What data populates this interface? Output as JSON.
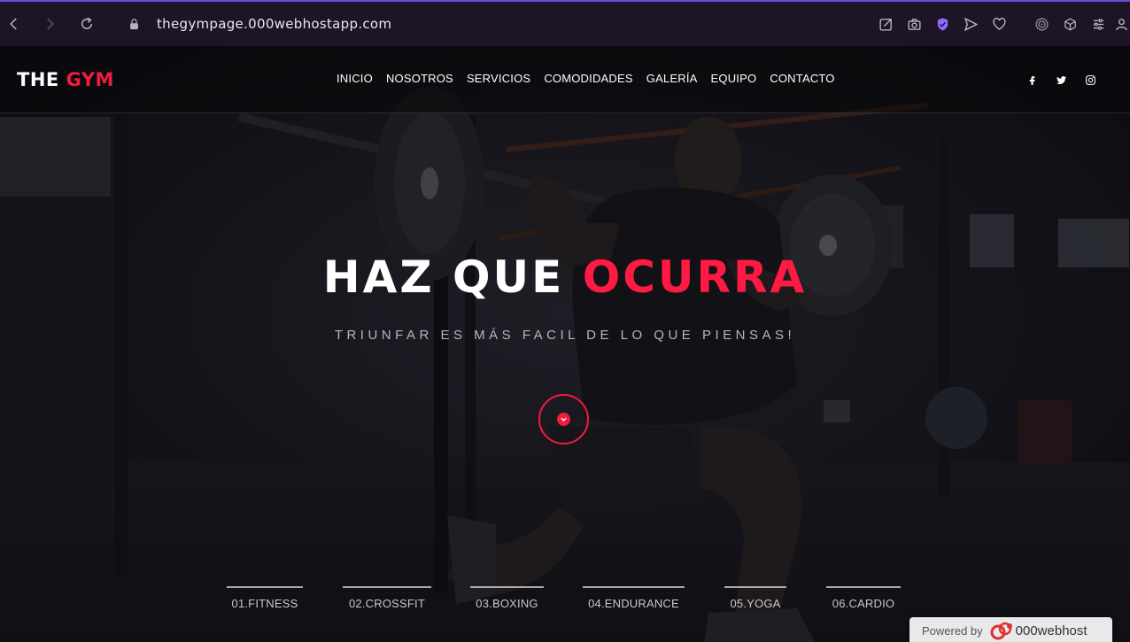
{
  "browser": {
    "url_host": "thegympage.000webhostapp.com",
    "icons": [
      "back-icon",
      "forward-icon",
      "reload-icon",
      "lock-icon",
      "share-icon",
      "camera-icon",
      "shield-icon",
      "send-icon",
      "heart-icon",
      "target-icon",
      "cube-icon",
      "sliders-icon",
      "profile-icon"
    ]
  },
  "site": {
    "logo_white": "THE",
    "logo_red": "GYM",
    "menu": [
      "INICIO",
      "NOSOTROS",
      "SERVICIOS",
      "COMODIDADES",
      "GALERÍA",
      "EQUIPO",
      "CONTACTO"
    ],
    "social": [
      "facebook-icon",
      "twitter-icon",
      "instagram-icon"
    ],
    "headline_white": "HAZ QUE",
    "headline_red": "OCURRA",
    "subheadline": "TRIUNFAR ES MÁS FACIL DE LO QUE PIENSAS!",
    "classes": [
      "01.FITNESS",
      "02.CROSSFIT",
      "03.BOXING",
      "04.ENDURANCE",
      "05.YOGA",
      "06.CARDIO"
    ],
    "colors": {
      "accent": "#ee1c3f",
      "nav_bg": "#0a0a0c"
    }
  },
  "powered_by": {
    "label": "Powered by",
    "brand": "000webhost"
  }
}
